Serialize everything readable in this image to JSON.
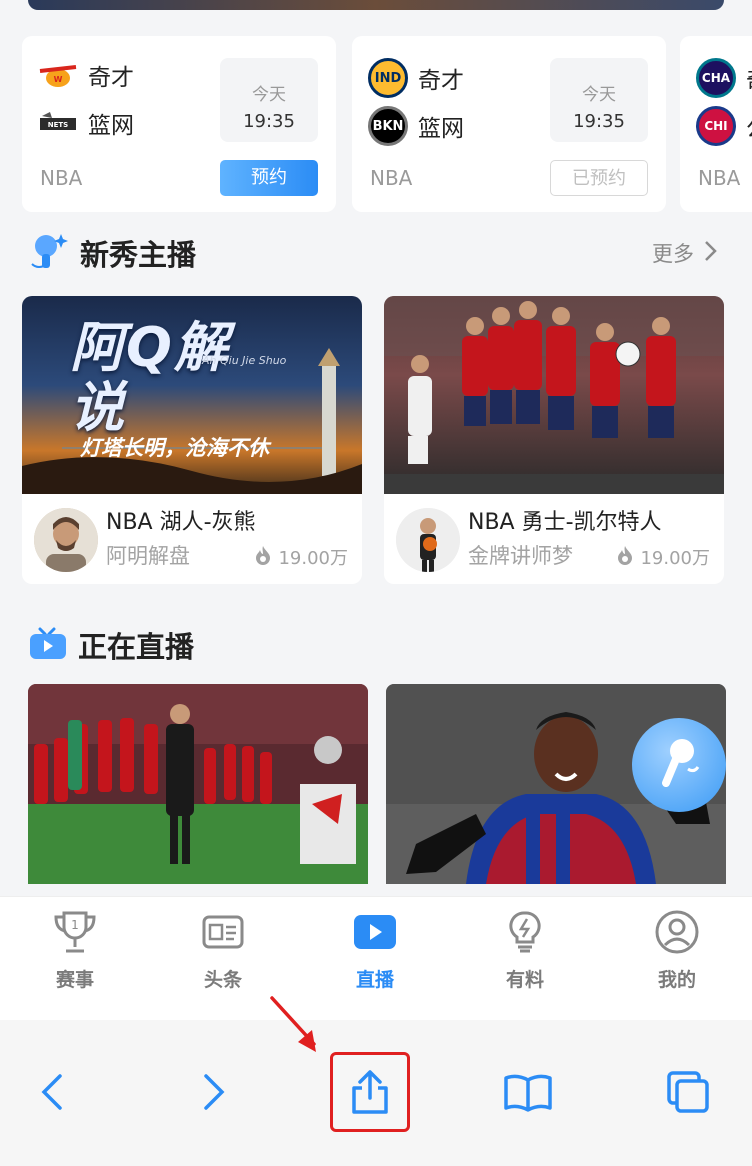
{
  "schedule": {
    "matches": [
      {
        "home": "奇才",
        "away": "篮网",
        "day": "今天",
        "time": "19:35",
        "league": "NBA",
        "action": "预约",
        "home_logo": "wizards-logo-icon",
        "away_logo": "nets-logo-icon"
      },
      {
        "home": "奇才",
        "away": "篮网",
        "day": "今天",
        "time": "19:35",
        "league": "NBA",
        "action": "已预约",
        "home_logo": "IND",
        "away_logo": "BKN"
      },
      {
        "home": "奇",
        "away": "公",
        "league": "NBA",
        "home_logo": "CHA",
        "away_logo": "CHI"
      }
    ]
  },
  "rookie": {
    "title": "新秀主播",
    "more": "更多",
    "cards": [
      {
        "thumb_title": "阿Q解说",
        "thumb_script": "Ah Qiu Jie Shuo",
        "thumb_sub": "灯塔长明，沧海不休",
        "title": "NBA   湖人-灰熊",
        "anchor": "阿明解盘",
        "heat": "19.00万"
      },
      {
        "title": "NBA   勇士-凯尔特人",
        "anchor": "金牌讲师梦",
        "heat": "19.00万"
      }
    ]
  },
  "live": {
    "title": "正在直播"
  },
  "tabbar": {
    "tabs": [
      {
        "label": "赛事",
        "icon": "trophy-icon"
      },
      {
        "label": "头条",
        "icon": "news-card-icon"
      },
      {
        "label": "直播",
        "icon": "play-icon"
      },
      {
        "label": "有料",
        "icon": "lightbulb-icon"
      },
      {
        "label": "我的",
        "icon": "user-icon"
      }
    ],
    "active": "直播"
  },
  "browser": {
    "buttons": [
      "back-icon",
      "forward-icon",
      "share-icon",
      "bookmarks-icon",
      "tabs-icon"
    ]
  },
  "colors": {
    "accent": "#2b8cf5",
    "highlight": "#e02020"
  }
}
